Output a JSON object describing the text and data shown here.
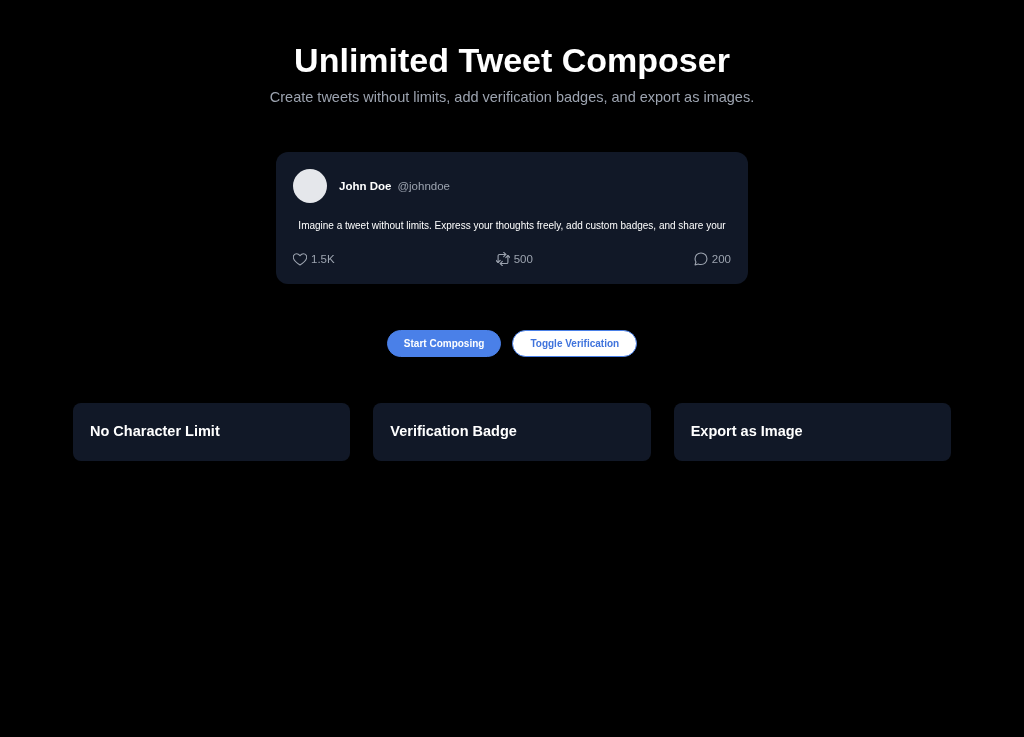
{
  "header": {
    "title": "Unlimited Tweet Composer",
    "subtitle": "Create tweets without limits, add verification badges, and export as images."
  },
  "tweet": {
    "name": "John Doe",
    "handle": "@johndoe",
    "text": "Imagine a tweet without limits. Express your thoughts freely, add custom badges, and share your",
    "stats": [
      {
        "kind": "like",
        "count": "1.5K"
      },
      {
        "kind": "retweet",
        "count": "500"
      },
      {
        "kind": "reply",
        "count": "200"
      }
    ]
  },
  "buttons": [
    {
      "kind": "primary",
      "label": "Start Composing"
    },
    {
      "kind": "secondary",
      "label": "Toggle Verification"
    }
  ],
  "features": [
    {
      "title": "No Character Limit"
    },
    {
      "title": "Verification Badge"
    },
    {
      "title": "Export as Image"
    }
  ]
}
